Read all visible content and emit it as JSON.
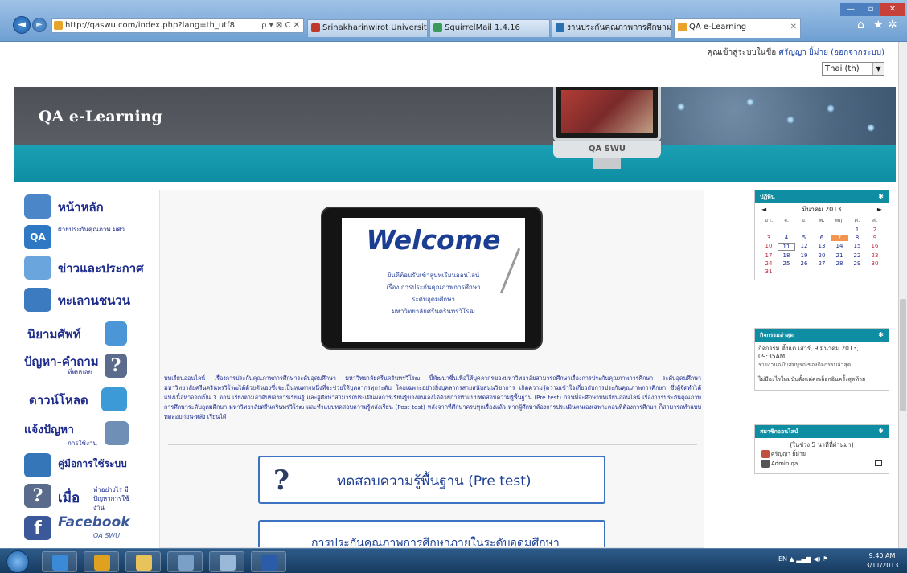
{
  "browser": {
    "url": "http://qaswu.com/index.php?lang=th_utf8",
    "addr_controls": "ρ ▾ ⊠ C ✕",
    "tabs": [
      {
        "label": "Srinakharinwirot University : ...",
        "color": "#c0392b"
      },
      {
        "label": "SquirrelMail 1.4.16",
        "color": "#3a9a5a"
      },
      {
        "label": "งานประกันคุณภาพการศึกษามศว",
        "color": "#2a6fb0"
      },
      {
        "label": "QA e-Learning",
        "color": "#e8a32b"
      }
    ],
    "window_controls": {
      "min": "—",
      "max": "▫",
      "close": "✕"
    }
  },
  "header": {
    "login_text": "คุณเข้าสู่ระบบในชื่อ ",
    "login_user": "ศรัญญา ยิ้ม่าย",
    "logout_text": "(ออกจากระบบ)",
    "language": "Thai (th)"
  },
  "banner": {
    "title": "QA e-Learning",
    "monitor_logo": "QA SWU"
  },
  "left_nav": [
    {
      "label": "หน้าหลัก",
      "sub": "",
      "icon": "user-home-icon",
      "color": "#4a86c8"
    },
    {
      "label": "",
      "sub": "ฝ่ายประกันคุณภาพ มศว",
      "icon": "qa-swu-logo-icon",
      "color": "#2f79c4"
    },
    {
      "label": "ข่าวและประกาศ",
      "sub": "",
      "icon": "megaphone-icon",
      "color": "#6aa6dd"
    },
    {
      "label": "ทะเลานชนวน",
      "sub": "",
      "icon": "computer-icon",
      "color": "#3d7bc0"
    },
    {
      "label": "นิยามศัพท์",
      "sub": "",
      "icon": "glossary-icon",
      "color": "#4b96d6"
    },
    {
      "label": "ปัญหา-คำถาม",
      "sub": "ที่พบบ่อย",
      "icon": "question-mark-icon",
      "color": "#5a6b8c"
    },
    {
      "label": "ดาวน์โหลด",
      "sub": "",
      "icon": "download-folder-icon",
      "color": "#3c9ad6"
    },
    {
      "label": "แจ้งปัญหา",
      "sub": "การใช้งาน",
      "icon": "report-problem-icon",
      "color": "#6f8fb6"
    },
    {
      "label": "คู่มือการใช้ระบบ",
      "sub": "",
      "icon": "manual-book-icon",
      "color": "#3476b8"
    },
    {
      "label": "เมื่อ",
      "sub": "ทำอย่างไร มีปัญหาการใช้งาน",
      "icon": "help-question-icon",
      "color": "#5a6b8c"
    },
    {
      "label": "Facebook",
      "sub": "QA SWU",
      "icon": "facebook-icon",
      "color": "#3b5998"
    }
  ],
  "main": {
    "welcome_title": "Welcome",
    "welcome_lines": [
      "ยินดีต้อนรับเข้าสู่บทเรียนออนไลน์",
      "เรื่อง การประกันคุณภาพการศึกษา",
      "ระดับอุดมศึกษา",
      "มหาวิทยาลัยศรีนครินทรวิโรฒ"
    ],
    "intro": "บทเรียนออนไลน์ เรื่องการประกันคุณภาพการศึกษาระดับอุดมศึกษา มหาวิทยาลัยศรีนครินทรวิโรฒ นี้พัฒนาขึ้นเพื่อให้บุคลากรของมหาวิทยาลัยสามารถศึกษาเรื่องการประกันคุณภาพการศึกษา ระดับอุดมศึกษา มหาวิทยาลัยศรีนครินทรวิโรฒได้ด้วยตัวเองซึ่งจะเป็นหนทางหนึ่งที่จะช่วยให้บุคลากรทุกระดับ โดยเฉพาะอย่างยิ่งบุคลากรสายสนับสนุนวิชาการ เกิดความรู้ความเข้าใจเกี่ยวกับการประกันคุณภาพการศึกษา ซึ่งผู้จัดทำได้แบ่งเนื้อหาออกเป็น 3 ตอน เรียงตามลำดับของการเรียนรู้ และผู้ศึกษาสามารถประเมินผลการเรียนรู้ของตนเองได้ด้วยการทำแบบทดสอบความรู้พื้นฐาน (Pre test) ก่อนที่จะศึกษาบทเรียนออนไลน์ เรื่องการประกันคุณภาพการศึกษาระดับอุดมศึกษา มหาวิทยาลัยศรีนครินทรวิโรฒ และทำแบบทดสอบความรู้หลังเรียน (Post test) หลังจากที่ศึกษาครบทุกเรื่องแล้ว หากผู้ศึกษาต้องการประเมินตนเองเฉพาะตอนที่ต้องการศึกษา ก็สามารถทำแบบทดสอบก่อน-หลัง เรียนได้",
    "pretest_label": "ทดสอบความรู้พื้นฐาน (Pre test)",
    "course_label": "การประกันคุณภาพการศึกษาภายในระดับอุดมศึกษา"
  },
  "calendar": {
    "block_title": "ปฏิทิน",
    "month": "มีนาคม 2013",
    "prev": "◄",
    "next": "►",
    "day_headers": [
      "อา.",
      "จ.",
      "อ.",
      "พ.",
      "พฤ.",
      "ศ.",
      "ส."
    ],
    "weeks": [
      [
        "",
        "",
        "",
        "",
        "",
        "1",
        "2"
      ],
      [
        "3",
        "4",
        "5",
        "6",
        "7",
        "8",
        "9"
      ],
      [
        "10",
        "11",
        "12",
        "13",
        "14",
        "15",
        "16"
      ],
      [
        "17",
        "18",
        "19",
        "20",
        "21",
        "22",
        "23"
      ],
      [
        "24",
        "25",
        "26",
        "27",
        "28",
        "29",
        "30"
      ],
      [
        "31",
        "",
        "",
        "",
        "",
        "",
        ""
      ]
    ],
    "today": "7",
    "selected": "11"
  },
  "recent": {
    "block_title": "กิจกรรมล่าสุด",
    "activity_line": "กิจกรรม ตั้งแต่ เสาร์, 9 มีนาคม 2013, 09:35AM",
    "report_link": "รายงานฉบับสมบูรณ์ของกิจกรรมล่าสุด",
    "note": "ไม่มีอะไรใหม่นับตั้งแต่คุณล็อกอินครั้งสุดท้าย"
  },
  "online": {
    "block_title": "สมาชิกออนไลน์",
    "caption": "(ในช่วง 5 นาทีที่ผ่านมา)",
    "users": [
      "ศรัญญา ยิ้ม่าย",
      "Admin qa"
    ]
  },
  "taskbar": {
    "lang": "EN",
    "time": "9:40 AM",
    "date": "3/11/2013",
    "apps": [
      {
        "name": "ie",
        "color": "#3a8ad8"
      },
      {
        "name": "chrome",
        "color": "#e0a020"
      },
      {
        "name": "explorer",
        "color": "#e8c25a"
      },
      {
        "name": "network",
        "color": "#7aa0c8"
      },
      {
        "name": "control",
        "color": "#9ab8d8"
      },
      {
        "name": "word",
        "color": "#2b5caa"
      }
    ]
  }
}
